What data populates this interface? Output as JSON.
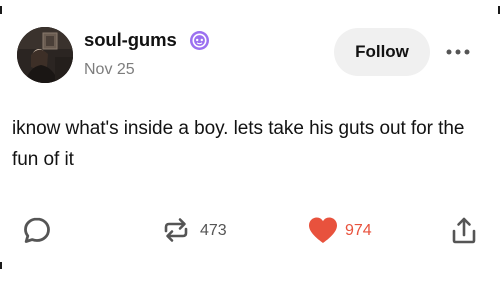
{
  "post": {
    "author": "soul-gums",
    "date": "Nov 25",
    "text": "iknow what's inside a boy. lets take his guts out for the fun of it",
    "avatar": "avatar-photo"
  },
  "header": {
    "follow_label": "Follow",
    "more_icon": "ellipsis-icon",
    "badge_icon": "verified-badge-icon",
    "badge_color": "#9b70f0"
  },
  "actions": {
    "reply_icon": "speech-bubble-icon",
    "reblog_icon": "reblog-icon",
    "reblog_count": "473",
    "like_icon": "heart-icon",
    "like_count": "974",
    "like_color": "#e8523d",
    "share_icon": "share-icon"
  }
}
